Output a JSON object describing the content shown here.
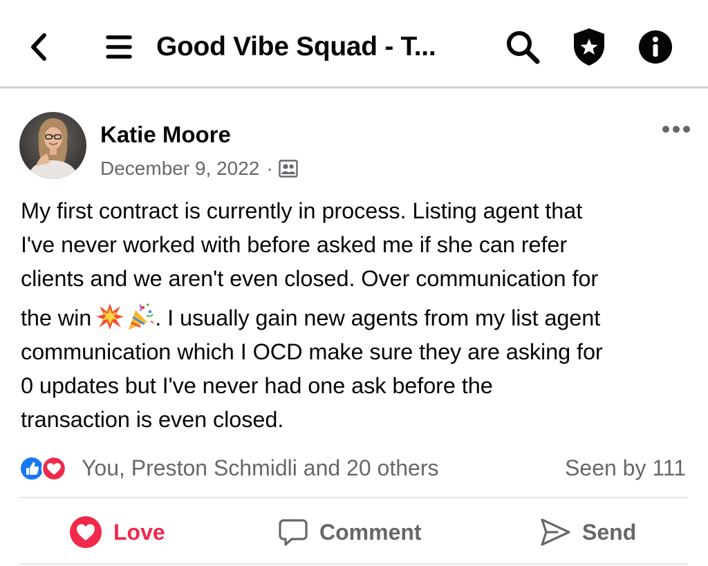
{
  "header": {
    "title": "Good Vibe Squad - T...",
    "back_icon": "chevron-left-icon",
    "menu_icon": "hamburger-menu-icon",
    "search_icon": "search-icon",
    "shield_icon": "shield-star-icon",
    "info_icon": "info-icon"
  },
  "post": {
    "author": "Katie Moore",
    "date": "December 9, 2022",
    "separator": "·",
    "privacy_icon": "members-group-icon",
    "more_icon": "more-horizontal-icon",
    "body": {
      "line1": "My first contract is currently in process. Listing agent that",
      "line2": "I've never worked with before asked me if she can refer",
      "line3": "clients and we aren't even closed. Over communication for",
      "line4_start": "the win",
      "line4_end": ". I usually gain new agents from my list agent",
      "line5": "communication which I OCD make sure they are asking for",
      "line6": "0 updates but I've never had one ask before the",
      "line7": "transaction is even closed.",
      "emojis": [
        "collision-emoji",
        "party-popper-emoji"
      ]
    }
  },
  "reactions": {
    "icons": [
      "like-icon",
      "love-icon"
    ],
    "reactors": "You, Preston Schmidli and 20 others",
    "seen": "Seen by 111"
  },
  "actions": {
    "love_label": "Love",
    "comment_label": "Comment",
    "send_label": "Send"
  },
  "colors": {
    "love": "#f0284a",
    "like": "#1877f2",
    "secondary_text": "#65676b",
    "primary_text": "#050505"
  }
}
